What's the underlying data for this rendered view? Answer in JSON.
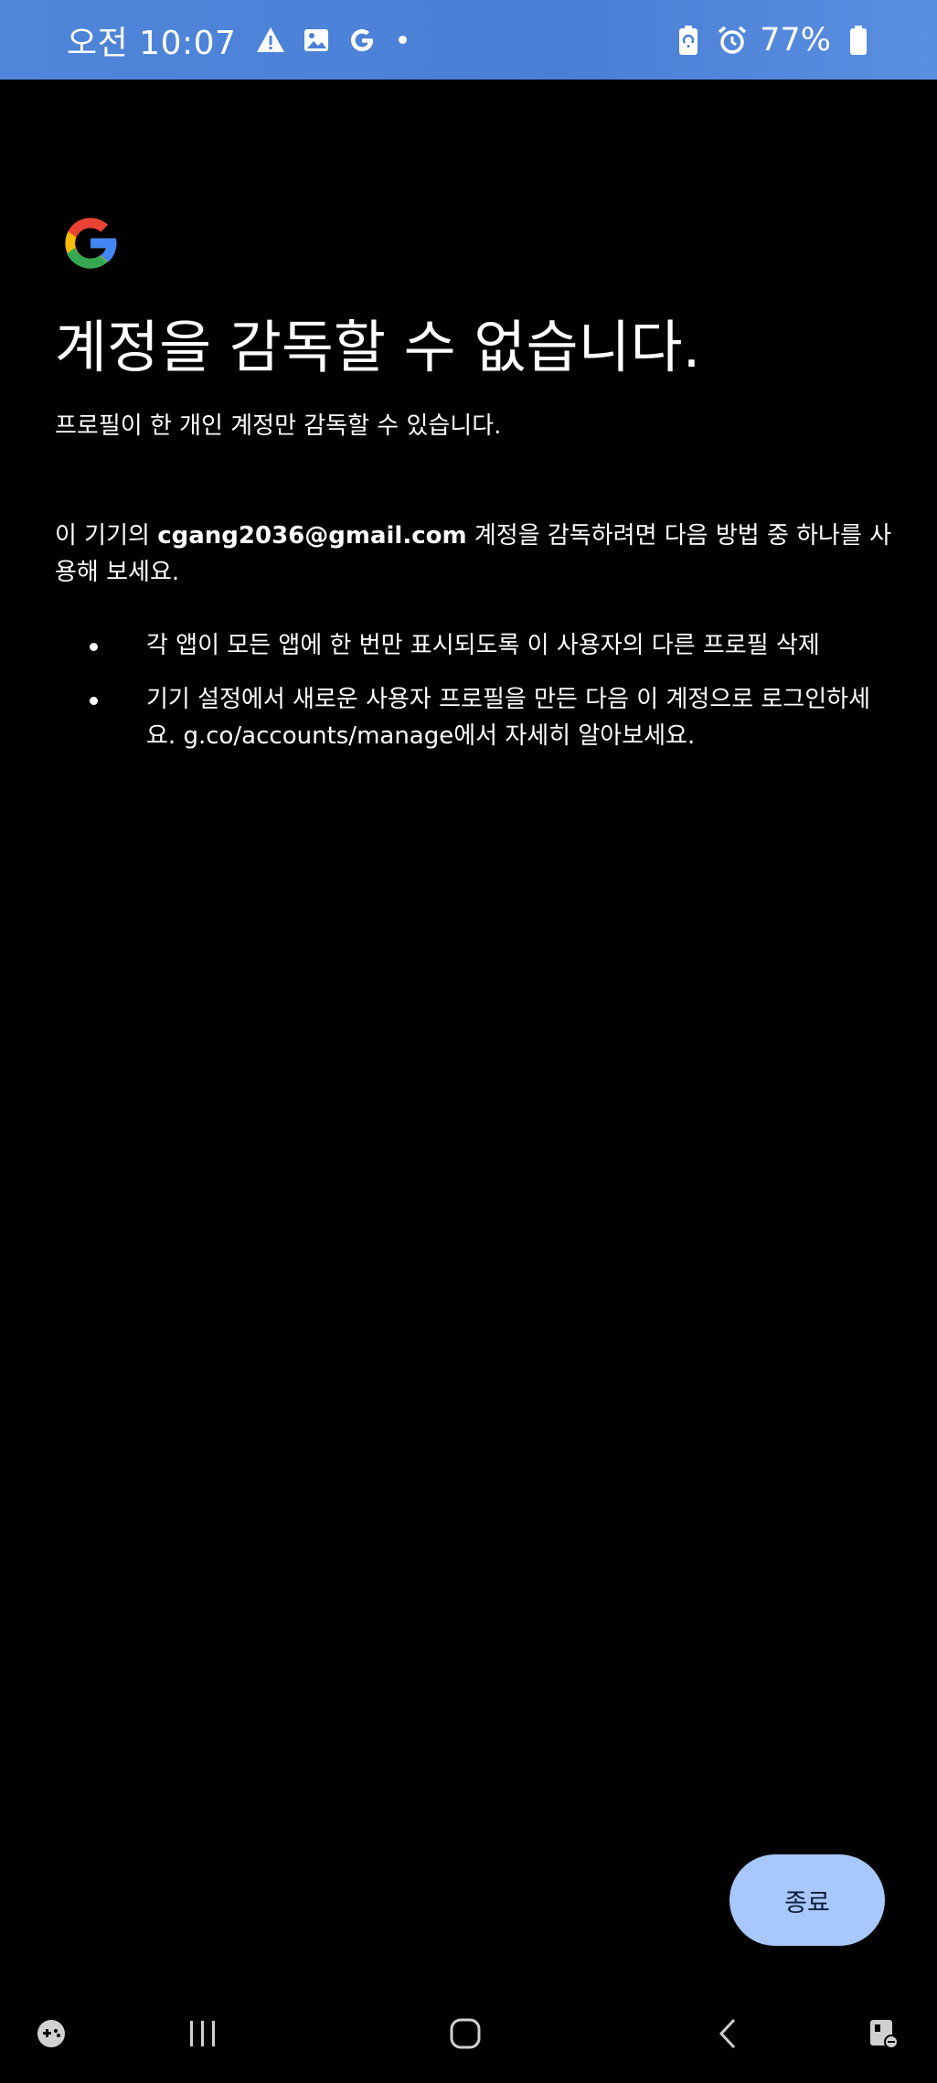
{
  "status_bar": {
    "time": "오전 10:07",
    "battery": "77%",
    "left_icons": [
      "warning-icon",
      "image-icon",
      "google-icon",
      "dot-icon"
    ],
    "right_icons": [
      "battery-saver-icon",
      "alarm-icon",
      "battery-icon"
    ]
  },
  "content": {
    "title": "계정을 감독할 수 없습니다.",
    "subtitle": "프로필이 한 개인 계정만 감독할 수 있습니다.",
    "body_prefix": "이 기기의 ",
    "email": "cgang2036@gmail.com",
    "body_suffix": " 계정을 감독하려면 다음 방법 중 하나를 사용해 보세요.",
    "bullets": [
      "각 앱이 모든 앱에 한 번만 표시되도록 이 사용자의 다른 프로필 삭제",
      "기기 설정에서 새로운 사용자 프로필을 만든 다음 이 계정으로 로그인하세요. g.co/accounts/manage에서 자세히 알아보세요."
    ]
  },
  "actions": {
    "exit_label": "종료"
  },
  "nav_bar": {
    "items": [
      "game-launcher-icon",
      "recent-apps-icon",
      "home-icon",
      "back-icon",
      "keyboard-switch-icon"
    ]
  },
  "colors": {
    "status_bar": "#4a7fd6",
    "background": "#000000",
    "button_bg": "#a8c7fa",
    "button_text": "#0b1d3a",
    "google_blue": "#4285F4",
    "google_red": "#EA4335",
    "google_yellow": "#FBBC05",
    "google_green": "#34A853"
  }
}
